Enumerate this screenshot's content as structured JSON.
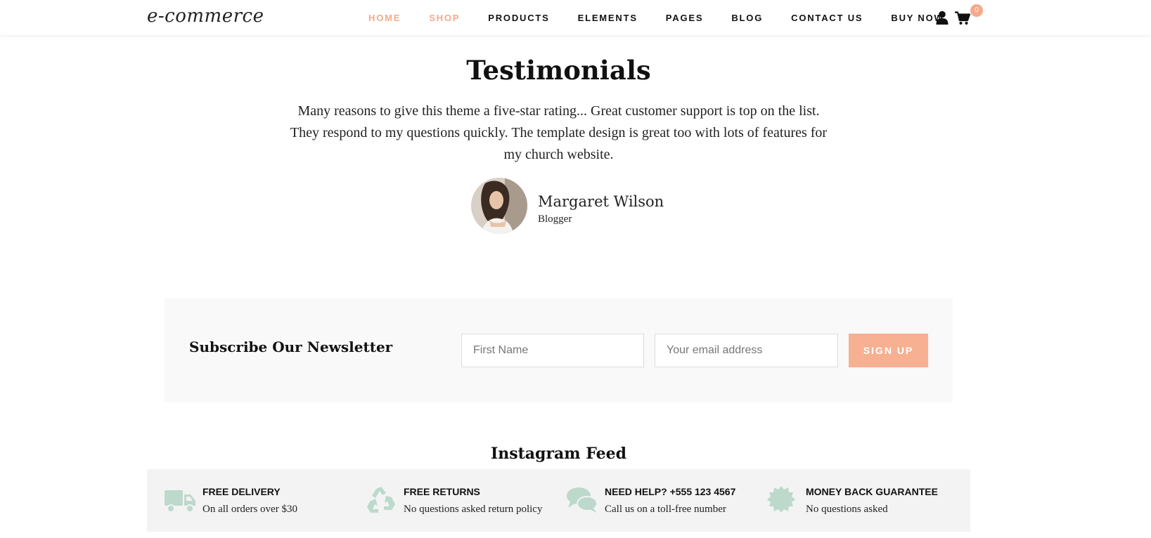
{
  "header": {
    "logo": "e-commerce",
    "nav": [
      "HOME",
      "SHOP",
      "PRODUCTS",
      "ELEMENTS",
      "PAGES",
      "BLOG",
      "CONTACT US",
      "BUY NOW"
    ],
    "cart_count": "0",
    "accent_color": "#f5a98a"
  },
  "testimonials": {
    "title": "Testimonials",
    "quote": "Many reasons to give this theme a five-star rating... Great customer support is top on the list. They respond to my questions quickly. The template design is great too with lots of features for my church website.",
    "author_name": "Margaret Wilson",
    "author_role": "Blogger"
  },
  "newsletter": {
    "title": "Subscribe Our Newsletter",
    "first_name_placeholder": "First Name",
    "email_placeholder": "Your email address",
    "button_label": "SIGN UP",
    "button_color": "#f7b091"
  },
  "instagram": {
    "title": "Instagram Feed"
  },
  "features": [
    {
      "icon": "truck-icon",
      "title": "FREE DELIVERY",
      "desc": "On all orders over $30"
    },
    {
      "icon": "recycle-icon",
      "title": "FREE RETURNS",
      "desc": "No questions asked return policy"
    },
    {
      "icon": "chat-bubbles-icon",
      "title": "NEED HELP? +555 123 4567",
      "desc": "Call us on a toll-free number"
    },
    {
      "icon": "badge-icon",
      "title": "MONEY BACK GUARANTEE",
      "desc": "No questions asked"
    }
  ],
  "feature_icon_color": "#bcd9cc"
}
